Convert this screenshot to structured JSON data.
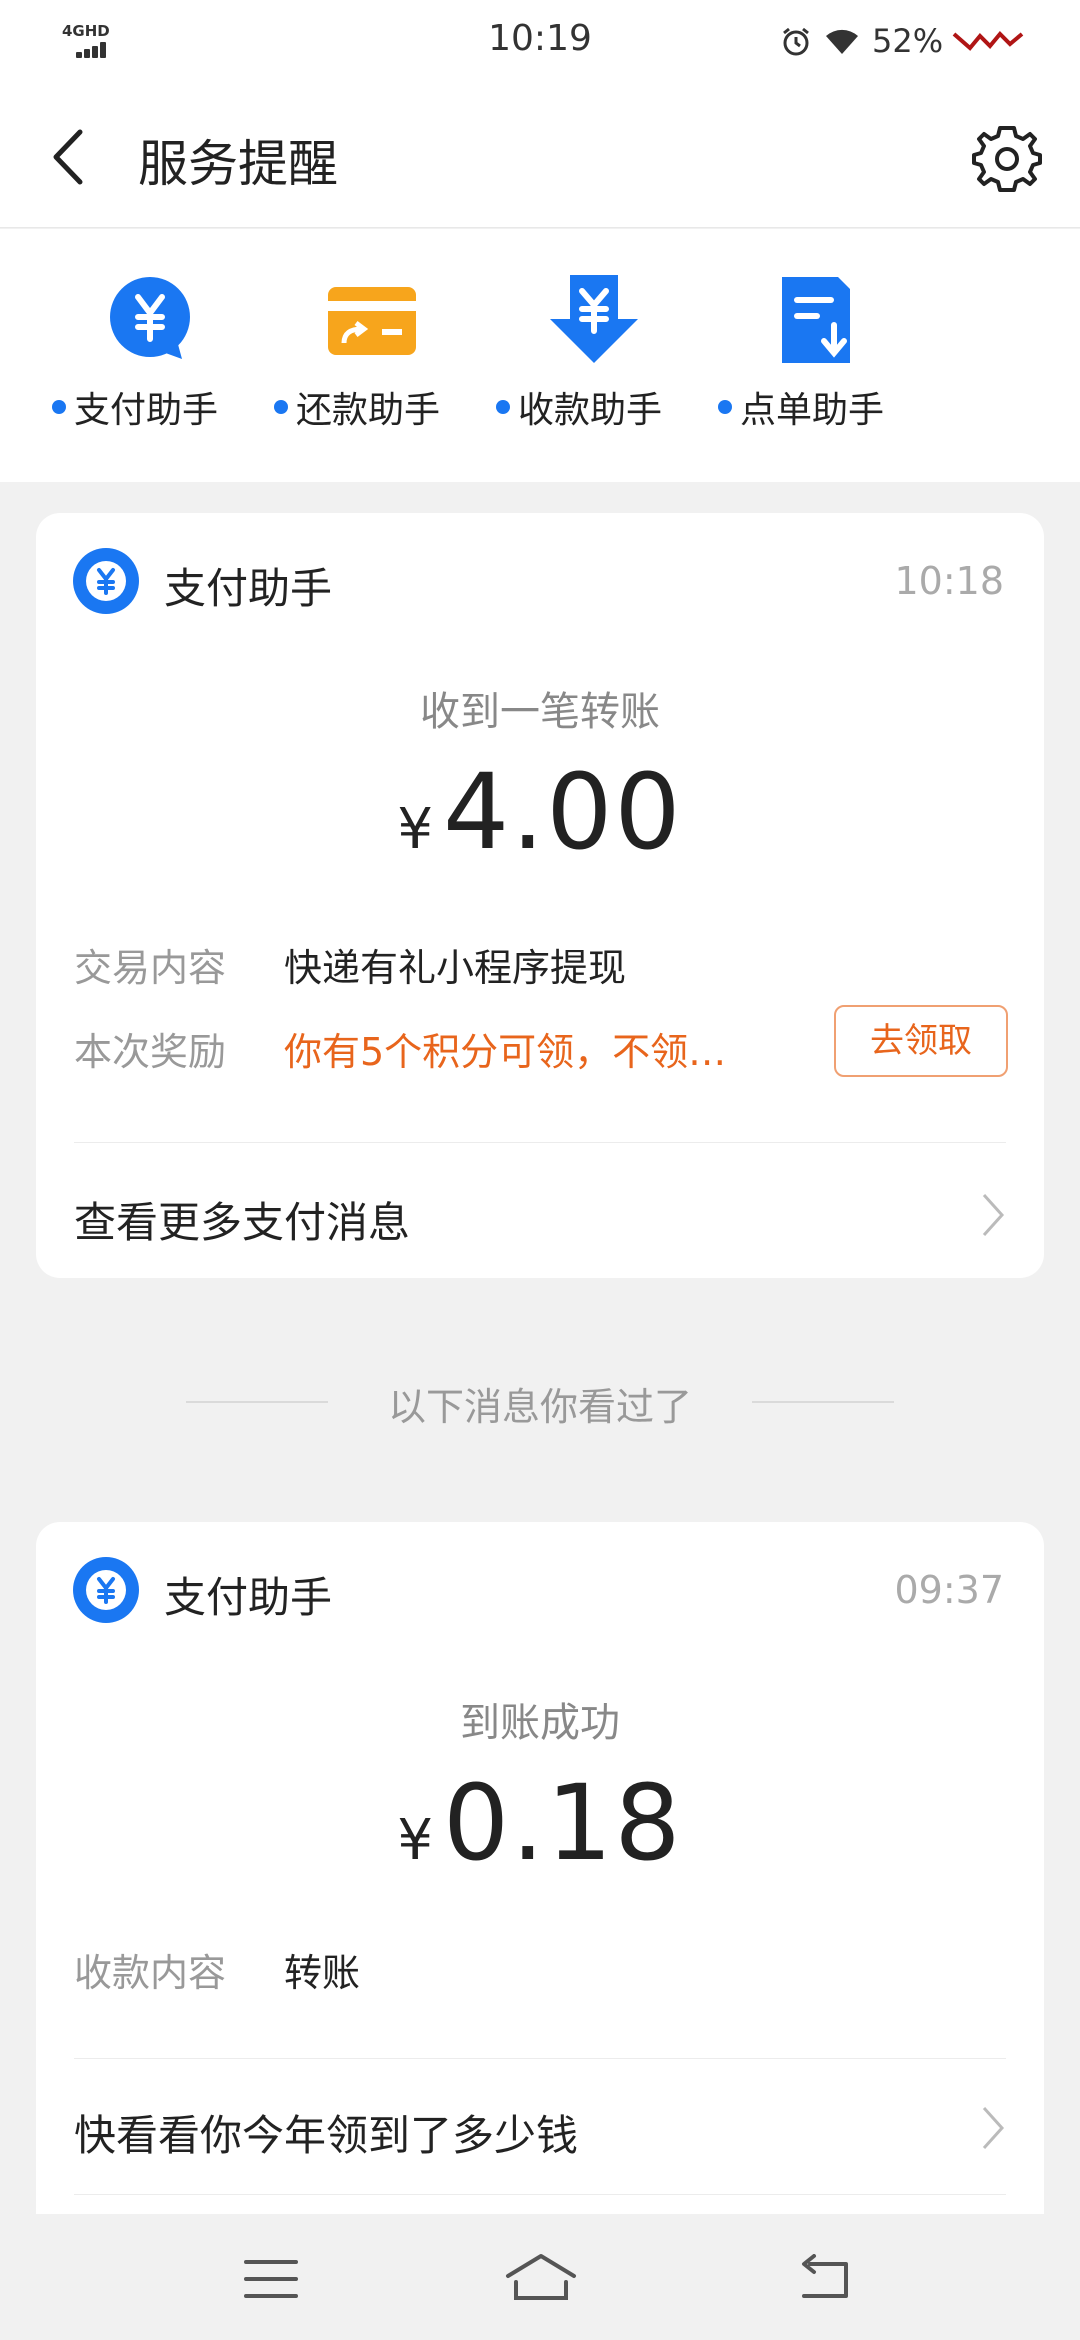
{
  "status_bar": {
    "network": "4GHD",
    "time": "10:19",
    "battery": "52%"
  },
  "header": {
    "title": "服务提醒",
    "icons": {
      "back": "chevron-left-icon",
      "settings": "gear-icon"
    }
  },
  "shortcuts": [
    {
      "label": "支付助手",
      "icon": "yen-bubble-icon"
    },
    {
      "label": "还款助手",
      "icon": "card-transfer-icon"
    },
    {
      "label": "收款助手",
      "icon": "yen-down-arrow-icon"
    },
    {
      "label": "点单助手",
      "icon": "order-doc-icon"
    }
  ],
  "colors": {
    "accent_blue": "#1a77f2",
    "card_orange": "#f7a51c",
    "highlight_orange": "#e8651c"
  },
  "notifications": [
    {
      "source": "支付助手",
      "time": "10:18",
      "subtitle": "收到一笔转账",
      "currency": "¥",
      "amount": "4.00",
      "rows": [
        {
          "key": "交易内容",
          "value": "快递有礼小程序提现"
        },
        {
          "key": "本次奖励",
          "value": "你有5个积分可领，不领…"
        }
      ],
      "action_label": "去领取",
      "more_link": "查看更多支付消息"
    },
    {
      "source": "支付助手",
      "time": "09:37",
      "subtitle": "到账成功",
      "currency": "¥",
      "amount": "0.18",
      "rows": [
        {
          "key": "收款内容",
          "value": "转账"
        }
      ],
      "more_link": "快看看你今年领到了多少钱"
    }
  ],
  "seen_divider": "以下消息你看过了",
  "nav_bar": {
    "icons": [
      "menu-icon",
      "home-icon",
      "back-icon"
    ]
  }
}
